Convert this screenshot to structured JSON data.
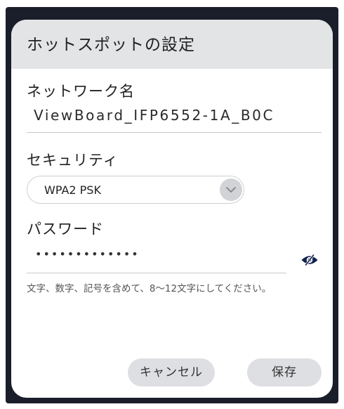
{
  "dialog": {
    "title": "ホットスポットの設定"
  },
  "network_name": {
    "label": "ネットワーク名",
    "value": "ViewBoard_IFP6552-1A_B0C"
  },
  "security": {
    "label": "セキュリティ",
    "selected": "WPA2 PSK",
    "arrow_icon": "chevron-down-icon"
  },
  "password": {
    "label": "パスワード",
    "masked_value": "•••••••••••••",
    "visibility_icon": "eye-icon"
  },
  "hint": "文字、数字、記号を含めて、8〜12文字にしてください。",
  "buttons": {
    "cancel": "キャンセル",
    "save": "保存"
  },
  "colors": {
    "header_background": "#e3e4e6",
    "eye_icon": "#12224f",
    "button_background": "#dedfe2",
    "backdrop": "#1a1d2a"
  }
}
